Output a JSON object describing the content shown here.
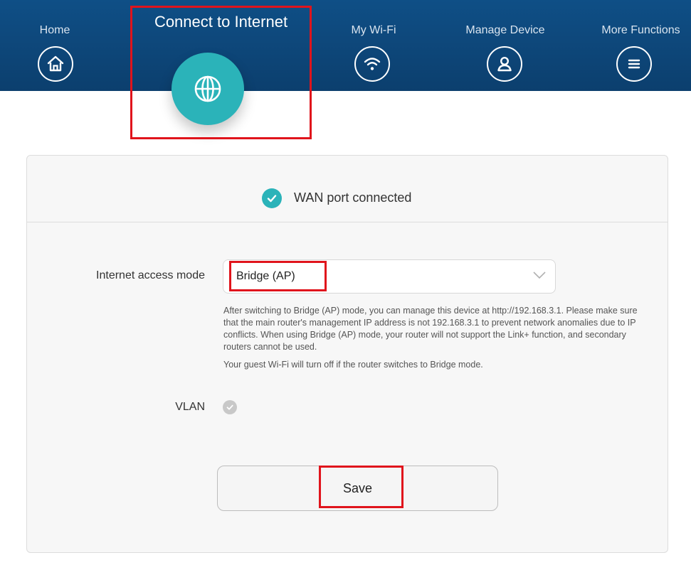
{
  "nav": {
    "items": [
      {
        "label": "Home",
        "icon": "home-icon"
      },
      {
        "label": "Connect to Internet",
        "icon": "globe-icon",
        "active": true
      },
      {
        "label": "My Wi-Fi",
        "icon": "wifi-icon"
      },
      {
        "label": "Manage Device",
        "icon": "user-icon"
      },
      {
        "label": "More Functions",
        "icon": "menu-icon"
      }
    ]
  },
  "status": {
    "text": "WAN port connected",
    "icon": "check-icon"
  },
  "form": {
    "access_mode_label": "Internet access mode",
    "access_mode_value": "Bridge (AP)",
    "help_line1": "After switching to Bridge (AP) mode, you can manage this device at http://192.168.3.1. Please make sure that the main router's management IP address is not 192.168.3.1 to prevent network anomalies due to IP conflicts. When using Bridge (AP) mode, your router will not support the Link+ function, and secondary routers cannot be used.",
    "help_line2": "Your guest Wi-Fi will turn off if the router switches to Bridge mode.",
    "vlan_label": "VLAN",
    "vlan_enabled": false,
    "save_label": "Save"
  },
  "colors": {
    "header": "#0f4f86",
    "accent": "#2bb3b9",
    "highlight": "#e0141c"
  }
}
